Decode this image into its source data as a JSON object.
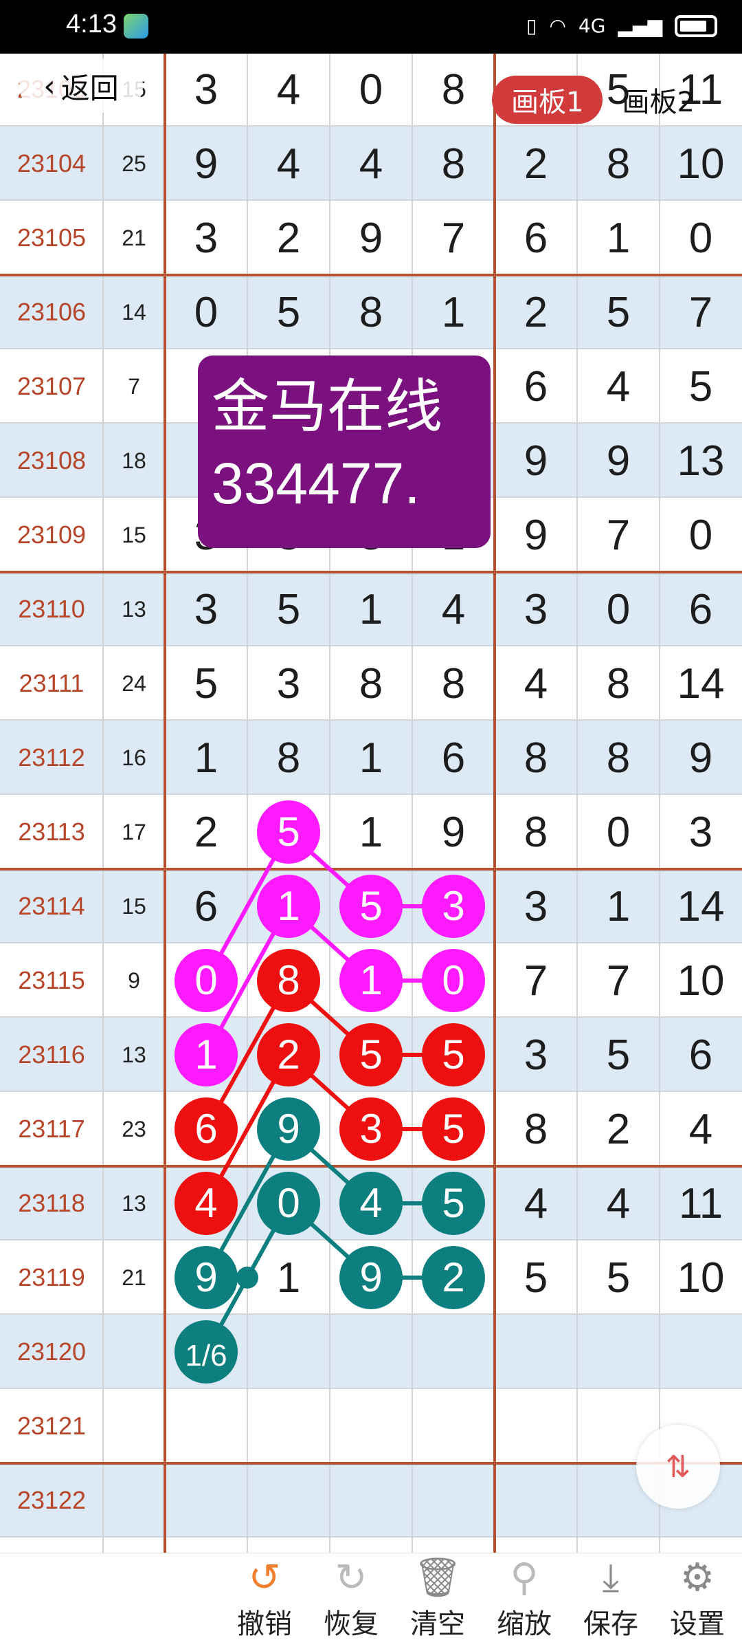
{
  "status": {
    "time": "4:13",
    "network": "4G"
  },
  "nav": {
    "back_label": "返回"
  },
  "tabs": [
    {
      "label": "画板1",
      "active": true
    },
    {
      "label": "画板2",
      "active": false
    }
  ],
  "watermark": {
    "line1": "金马在线",
    "line2": "334477."
  },
  "rows": [
    {
      "id": "23103",
      "sum": "15",
      "digits": [
        "3",
        "4",
        "0",
        "8",
        "",
        "5",
        "11"
      ]
    },
    {
      "id": "23104",
      "sum": "25",
      "digits": [
        "9",
        "4",
        "4",
        "8",
        "2",
        "8",
        "10"
      ]
    },
    {
      "id": "23105",
      "sum": "21",
      "digits": [
        "3",
        "2",
        "9",
        "7",
        "6",
        "1",
        "0"
      ]
    },
    {
      "id": "23106",
      "sum": "14",
      "digits": [
        "0",
        "5",
        "8",
        "1",
        "2",
        "5",
        "7"
      ]
    },
    {
      "id": "23107",
      "sum": "7",
      "digits": [
        "",
        "",
        "",
        "",
        "6",
        "4",
        "5"
      ]
    },
    {
      "id": "23108",
      "sum": "18",
      "digits": [
        "",
        "",
        "",
        "",
        "9",
        "9",
        "13"
      ]
    },
    {
      "id": "23109",
      "sum": "15",
      "digits": [
        "3",
        "8",
        "3",
        "1",
        "9",
        "7",
        "0"
      ]
    },
    {
      "id": "23110",
      "sum": "13",
      "digits": [
        "3",
        "5",
        "1",
        "4",
        "3",
        "0",
        "6"
      ]
    },
    {
      "id": "23111",
      "sum": "24",
      "digits": [
        "5",
        "3",
        "8",
        "8",
        "4",
        "8",
        "14"
      ]
    },
    {
      "id": "23112",
      "sum": "16",
      "digits": [
        "1",
        "8",
        "1",
        "6",
        "8",
        "8",
        "9"
      ]
    },
    {
      "id": "23113",
      "sum": "17",
      "digits": [
        "2",
        "5",
        "1",
        "9",
        "8",
        "0",
        "3"
      ]
    },
    {
      "id": "23114",
      "sum": "15",
      "digits": [
        "6",
        "1",
        "5",
        "3",
        "3",
        "1",
        "14"
      ]
    },
    {
      "id": "23115",
      "sum": "9",
      "digits": [
        "0",
        "8",
        "1",
        "0",
        "7",
        "7",
        "10"
      ]
    },
    {
      "id": "23116",
      "sum": "13",
      "digits": [
        "1",
        "2",
        "5",
        "5",
        "3",
        "5",
        "6"
      ]
    },
    {
      "id": "23117",
      "sum": "23",
      "digits": [
        "6",
        "9",
        "3",
        "5",
        "8",
        "2",
        "4"
      ]
    },
    {
      "id": "23118",
      "sum": "13",
      "digits": [
        "4",
        "0",
        "4",
        "5",
        "4",
        "4",
        "11"
      ]
    },
    {
      "id": "23119",
      "sum": "21",
      "digits": [
        "9",
        "1",
        "9",
        "2",
        "5",
        "5",
        "10"
      ]
    },
    {
      "id": "23120",
      "sum": "",
      "digits": [
        "",
        "",
        "",
        "",
        "",
        "",
        ""
      ]
    },
    {
      "id": "23121",
      "sum": "",
      "digits": [
        "",
        "",
        "",
        "",
        "",
        "",
        ""
      ]
    },
    {
      "id": "23122",
      "sum": "",
      "digits": [
        "",
        "",
        "",
        "",
        "",
        "",
        ""
      ]
    }
  ],
  "markers": {
    "colors": {
      "magenta": "#ff1aff",
      "red": "#ee1010",
      "teal": "#0d7f7e"
    },
    "nodes": [
      {
        "row": 10,
        "col": 1,
        "label": "5",
        "color": "magenta"
      },
      {
        "row": 11,
        "col": 1,
        "label": "1",
        "color": "magenta"
      },
      {
        "row": 11,
        "col": 2,
        "label": "5",
        "color": "magenta"
      },
      {
        "row": 11,
        "col": 3,
        "label": "3",
        "color": "magenta"
      },
      {
        "row": 12,
        "col": 0,
        "label": "0",
        "color": "magenta"
      },
      {
        "row": 12,
        "col": 2,
        "label": "1",
        "color": "magenta"
      },
      {
        "row": 12,
        "col": 3,
        "label": "0",
        "color": "magenta"
      },
      {
        "row": 13,
        "col": 0,
        "label": "1",
        "color": "magenta"
      },
      {
        "row": 12,
        "col": 1,
        "label": "8",
        "color": "red"
      },
      {
        "row": 13,
        "col": 1,
        "label": "2",
        "color": "red"
      },
      {
        "row": 13,
        "col": 2,
        "label": "5",
        "color": "red"
      },
      {
        "row": 13,
        "col": 3,
        "label": "5",
        "color": "red"
      },
      {
        "row": 14,
        "col": 0,
        "label": "6",
        "color": "red"
      },
      {
        "row": 14,
        "col": 2,
        "label": "3",
        "color": "red"
      },
      {
        "row": 14,
        "col": 3,
        "label": "5",
        "color": "red"
      },
      {
        "row": 15,
        "col": 0,
        "label": "4",
        "color": "red"
      },
      {
        "row": 14,
        "col": 1,
        "label": "9",
        "color": "teal"
      },
      {
        "row": 15,
        "col": 1,
        "label": "0",
        "color": "teal"
      },
      {
        "row": 15,
        "col": 2,
        "label": "4",
        "color": "teal"
      },
      {
        "row": 15,
        "col": 3,
        "label": "5",
        "color": "teal"
      },
      {
        "row": 16,
        "col": 0,
        "label": "9",
        "color": "teal"
      },
      {
        "row": 16,
        "col": 2,
        "label": "9",
        "color": "teal"
      },
      {
        "row": 16,
        "col": 3,
        "label": "2",
        "color": "teal"
      },
      {
        "row": 17,
        "col": 0,
        "label": "1/6",
        "color": "teal"
      }
    ],
    "links": [
      {
        "from": [
          10,
          1
        ],
        "to": [
          11,
          2
        ],
        "color": "magenta"
      },
      {
        "from": [
          11,
          2
        ],
        "to": [
          11,
          3
        ],
        "color": "magenta"
      },
      {
        "from": [
          10,
          1
        ],
        "to": [
          12,
          0
        ],
        "color": "magenta"
      },
      {
        "from": [
          11,
          1
        ],
        "to": [
          12,
          2
        ],
        "color": "magenta"
      },
      {
        "from": [
          12,
          2
        ],
        "to": [
          12,
          3
        ],
        "color": "magenta"
      },
      {
        "from": [
          11,
          1
        ],
        "to": [
          13,
          0
        ],
        "color": "magenta"
      },
      {
        "from": [
          12,
          1
        ],
        "to": [
          13,
          2
        ],
        "color": "red"
      },
      {
        "from": [
          13,
          2
        ],
        "to": [
          13,
          3
        ],
        "color": "red"
      },
      {
        "from": [
          12,
          1
        ],
        "to": [
          14,
          0
        ],
        "color": "red"
      },
      {
        "from": [
          13,
          1
        ],
        "to": [
          14,
          2
        ],
        "color": "red"
      },
      {
        "from": [
          14,
          2
        ],
        "to": [
          14,
          3
        ],
        "color": "red"
      },
      {
        "from": [
          13,
          1
        ],
        "to": [
          15,
          0
        ],
        "color": "red"
      },
      {
        "from": [
          14,
          1
        ],
        "to": [
          15,
          2
        ],
        "color": "teal"
      },
      {
        "from": [
          15,
          2
        ],
        "to": [
          15,
          3
        ],
        "color": "teal"
      },
      {
        "from": [
          14,
          1
        ],
        "to": [
          16,
          0
        ],
        "color": "teal"
      },
      {
        "from": [
          15,
          1
        ],
        "to": [
          16,
          2
        ],
        "color": "teal"
      },
      {
        "from": [
          16,
          2
        ],
        "to": [
          16,
          3
        ],
        "color": "teal"
      },
      {
        "from": [
          15,
          1
        ],
        "to": [
          17,
          0
        ],
        "color": "teal"
      }
    ]
  },
  "toolbar": {
    "undo_label": "撤销",
    "redo_label": "恢复",
    "clear_label": "清空",
    "zoom_label": "缩放",
    "save_label": "保存",
    "settings_label": "设置"
  }
}
